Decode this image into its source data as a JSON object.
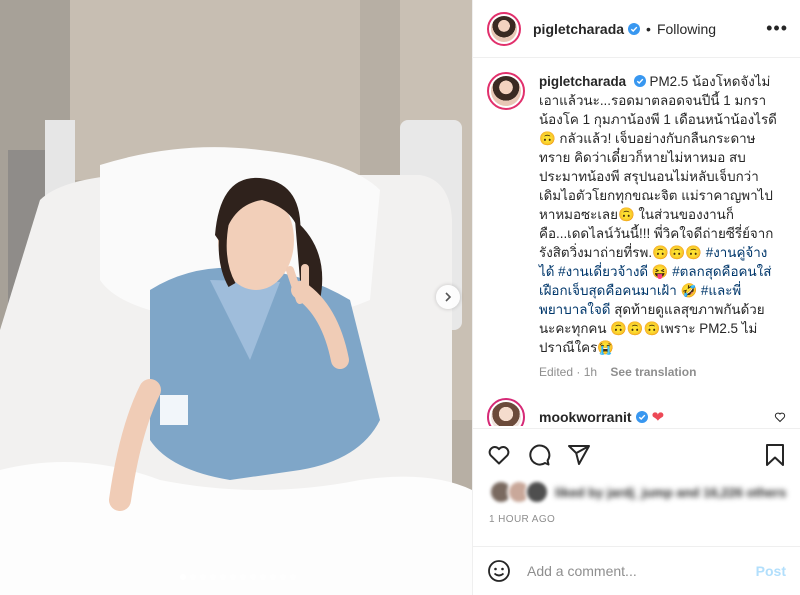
{
  "post": {
    "username": "pigletcharada",
    "follow_status": "Following",
    "more_icon": "more-horizontal-icon"
  },
  "caption": {
    "username": "pigletcharada",
    "text": "PM2.5 น้องโหดจังไม่เอาแล้วนะ...รอดมาตลอดจนปีนี้ 1 มกรา น้องโค 1 กุมภาน้องพี 1 เดือนหน้าน้องไรดี 🙃 กลัวแล้ว! เจ็บอย่างกับกลืนกระดาษทราย คิดว่าเดี๋ยวก็หายไม่หาหมอ สบประมาทน้องพี สรุปนอนไม่หลับเจ็บกว่าเดิมไอตัวโยกทุกขณะจิต แม่ราคาญพาไปหาหมอซะเลย🙃 ในส่วนของงานก็คือ...เดดไลน์วันนี้!!! พี่วิคใจดีถ่ายซีรี่ย์จากรังสิตวิ่งมาถ่ายที่รพ.🙃🙃🙃",
    "hashtag1": "#งานคู่จ้างได้",
    "hashtag2": "#งานเดี่ยวจ้างดี",
    "emoji1": "😝",
    "hashtag3": "#ตลกสุดคือคนใส่เฝือกเจ็บสุดคือคนมาเฝ้า",
    "emoji2": "🤣",
    "hashtag4": "#และพี่พยาบาลใจดี",
    "text2": "สุดท้ายดูแลสุขภาพกันด้วยนะคะทุกคน 🙃🙃🙃เพราะ PM2.5 ไม่ปราณีใคร😭",
    "edited": "Edited · 1h",
    "see_translation": "See translation"
  },
  "comment": {
    "username": "mookworranit",
    "emoji": "❤"
  },
  "likes": {
    "text": "liked by jardj_jump and 16,226 others"
  },
  "timestamp": "1 HOUR AGO",
  "add_comment": {
    "placeholder": "Add a comment...",
    "post_label": "Post"
  },
  "colors": {
    "link": "#00376b",
    "verified": "#3897f0",
    "post_disabled": "#b2dffc"
  }
}
